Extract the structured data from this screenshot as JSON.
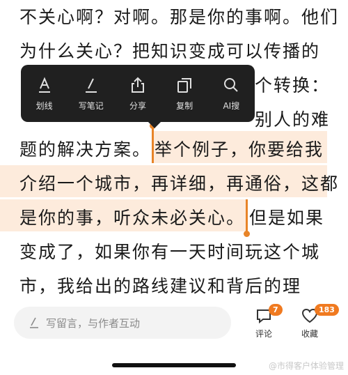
{
  "article": {
    "lines": [
      "不关心啊？对啊。那是你的事啊。他们",
      "为什么关心？把知识变成可以传播的",
      "个转换：",
      "别人的难",
      "题的解决方案。",
      "举个例子，你要给我",
      "介绍一个城市，再详细，再通俗，这都",
      "是你的事，听众未必关心。",
      "但是如果",
      "变成了，如果你有一天时间玩这个城",
      "市，我给出的路线建议和背后的理"
    ]
  },
  "toolbar": {
    "items": [
      {
        "label": "划线",
        "icon": "underline-a-icon"
      },
      {
        "label": "写笔记",
        "icon": "pen-icon"
      },
      {
        "label": "分享",
        "icon": "share-icon"
      },
      {
        "label": "复制",
        "icon": "copy-icon"
      },
      {
        "label": "AI搜",
        "icon": "search-icon"
      }
    ]
  },
  "comment_bar": {
    "placeholder": "写留言，与作者互动"
  },
  "actions": {
    "comment": {
      "label": "评论",
      "count": "7"
    },
    "favorite": {
      "label": "收藏",
      "count": "183"
    }
  },
  "watermark": "@市得客户体验管理",
  "colors": {
    "accent": "#e88428",
    "highlight": "#fdebdc",
    "toolbar_bg": "#202020"
  }
}
